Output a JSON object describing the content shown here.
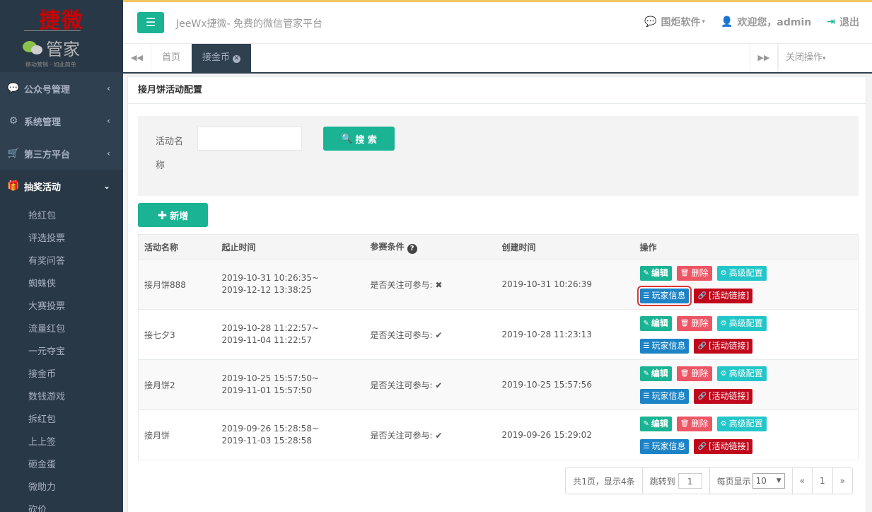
{
  "logo": {
    "brand_top": "捷微",
    "brand_bottom": "管家",
    "tagline": "移动营销 · 如此简单"
  },
  "topbar": {
    "title": "JeeWx捷微- 免费的微信管家平台",
    "company_menu": "国炬软件",
    "welcome": "欢迎您，admin",
    "logout": "退出"
  },
  "tabs": {
    "home": "首页",
    "current": "接金币",
    "close_ops": "关闭操作"
  },
  "sidebar": {
    "items": [
      {
        "label": "公众号管理",
        "icon": "wechat-icon"
      },
      {
        "label": "系统管理",
        "icon": "gear-icon"
      },
      {
        "label": "第三方平台",
        "icon": "cart-icon"
      },
      {
        "label": "抽奖活动",
        "icon": "gift-icon"
      }
    ],
    "sub_items": [
      "抢红包",
      "评选投票",
      "有奖问答",
      "蜘蛛侠",
      "大赛投票",
      "流量红包",
      "一元夺宝",
      "接金币",
      "数钱游戏",
      "拆红包",
      "上上签",
      "砸金蛋",
      "微助力",
      "砍价"
    ]
  },
  "panel": {
    "title": "接月饼活动配置"
  },
  "search": {
    "label": "活动名称",
    "value": "",
    "button": "搜 索"
  },
  "add_button": "新增",
  "table": {
    "headers": {
      "name": "活动名称",
      "time": "起止时间",
      "condition": "参赛条件",
      "created": "创建时间",
      "ops": "操作"
    },
    "ops_labels": {
      "edit": "编辑",
      "delete": "删除",
      "advanced": "高级配置",
      "players": "玩家信息",
      "link": "[活动链接]"
    },
    "condition_label": "是否关注可参与:",
    "rows": [
      {
        "name": "接月饼888",
        "start": "2019-10-31 10:26:35~",
        "end": "2019-12-12 13:38:25",
        "follow": "✖",
        "created": "2019-10-31 10:26:39"
      },
      {
        "name": "接七夕3",
        "start": "2019-10-28 11:22:57~",
        "end": "2019-11-04 11:22:57",
        "follow": "✔",
        "created": "2019-10-28 11:23:13"
      },
      {
        "name": "接月饼2",
        "start": "2019-10-25 15:57:50~",
        "end": "2019-11-01 15:57:50",
        "follow": "✔",
        "created": "2019-10-25 15:57:56"
      },
      {
        "name": "接月饼",
        "start": "2019-09-26 15:28:58~",
        "end": "2019-11-03 15:28:58",
        "follow": "✔",
        "created": "2019-09-26 15:29:02"
      }
    ]
  },
  "pager": {
    "summary": "共1页，显示4条",
    "jump_label": "跳转到",
    "jump_value": "1",
    "per_page_label": "每页显示",
    "per_page_value": "10",
    "prev": "«",
    "page": "1",
    "next": "»"
  }
}
